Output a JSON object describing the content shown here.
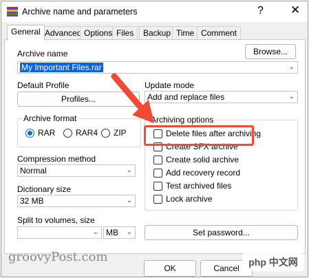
{
  "window": {
    "title": "Archive name and parameters",
    "help": "?",
    "close": "✕"
  },
  "tabs": [
    {
      "label": "General",
      "active": true
    },
    {
      "label": "Advanced"
    },
    {
      "label": "Options"
    },
    {
      "label": "Files"
    },
    {
      "label": "Backup"
    },
    {
      "label": "Time"
    },
    {
      "label": "Comment"
    }
  ],
  "archive_name": {
    "label": "Archive name",
    "value": "My Important Files.rar",
    "browse": "Browse..."
  },
  "default_profile": {
    "label": "Default Profile",
    "button": "Profiles..."
  },
  "update_mode": {
    "label": "Update mode",
    "value": "Add and replace files"
  },
  "archive_format": {
    "label": "Archive format",
    "options": [
      "RAR",
      "RAR4",
      "ZIP"
    ],
    "selected": "RAR"
  },
  "compression": {
    "label": "Compression method",
    "value": "Normal"
  },
  "dictionary": {
    "label": "Dictionary size",
    "value": "32 MB"
  },
  "split": {
    "label": "Split to volumes, size",
    "value": "",
    "unit": "MB"
  },
  "archiving_options": {
    "label": "Archiving options",
    "items": [
      "Delete files after archiving",
      "Create SFX archive",
      "Create solid archive",
      "Add recovery record",
      "Test archived files",
      "Lock archive"
    ]
  },
  "set_password": "Set password...",
  "buttons": {
    "ok": "OK",
    "cancel": "Cancel"
  },
  "watermark": "groovyPost.com",
  "php_badge": "php 中文网",
  "colors": {
    "accent": "#1c6ac7",
    "highlight": "#ef4a34"
  }
}
